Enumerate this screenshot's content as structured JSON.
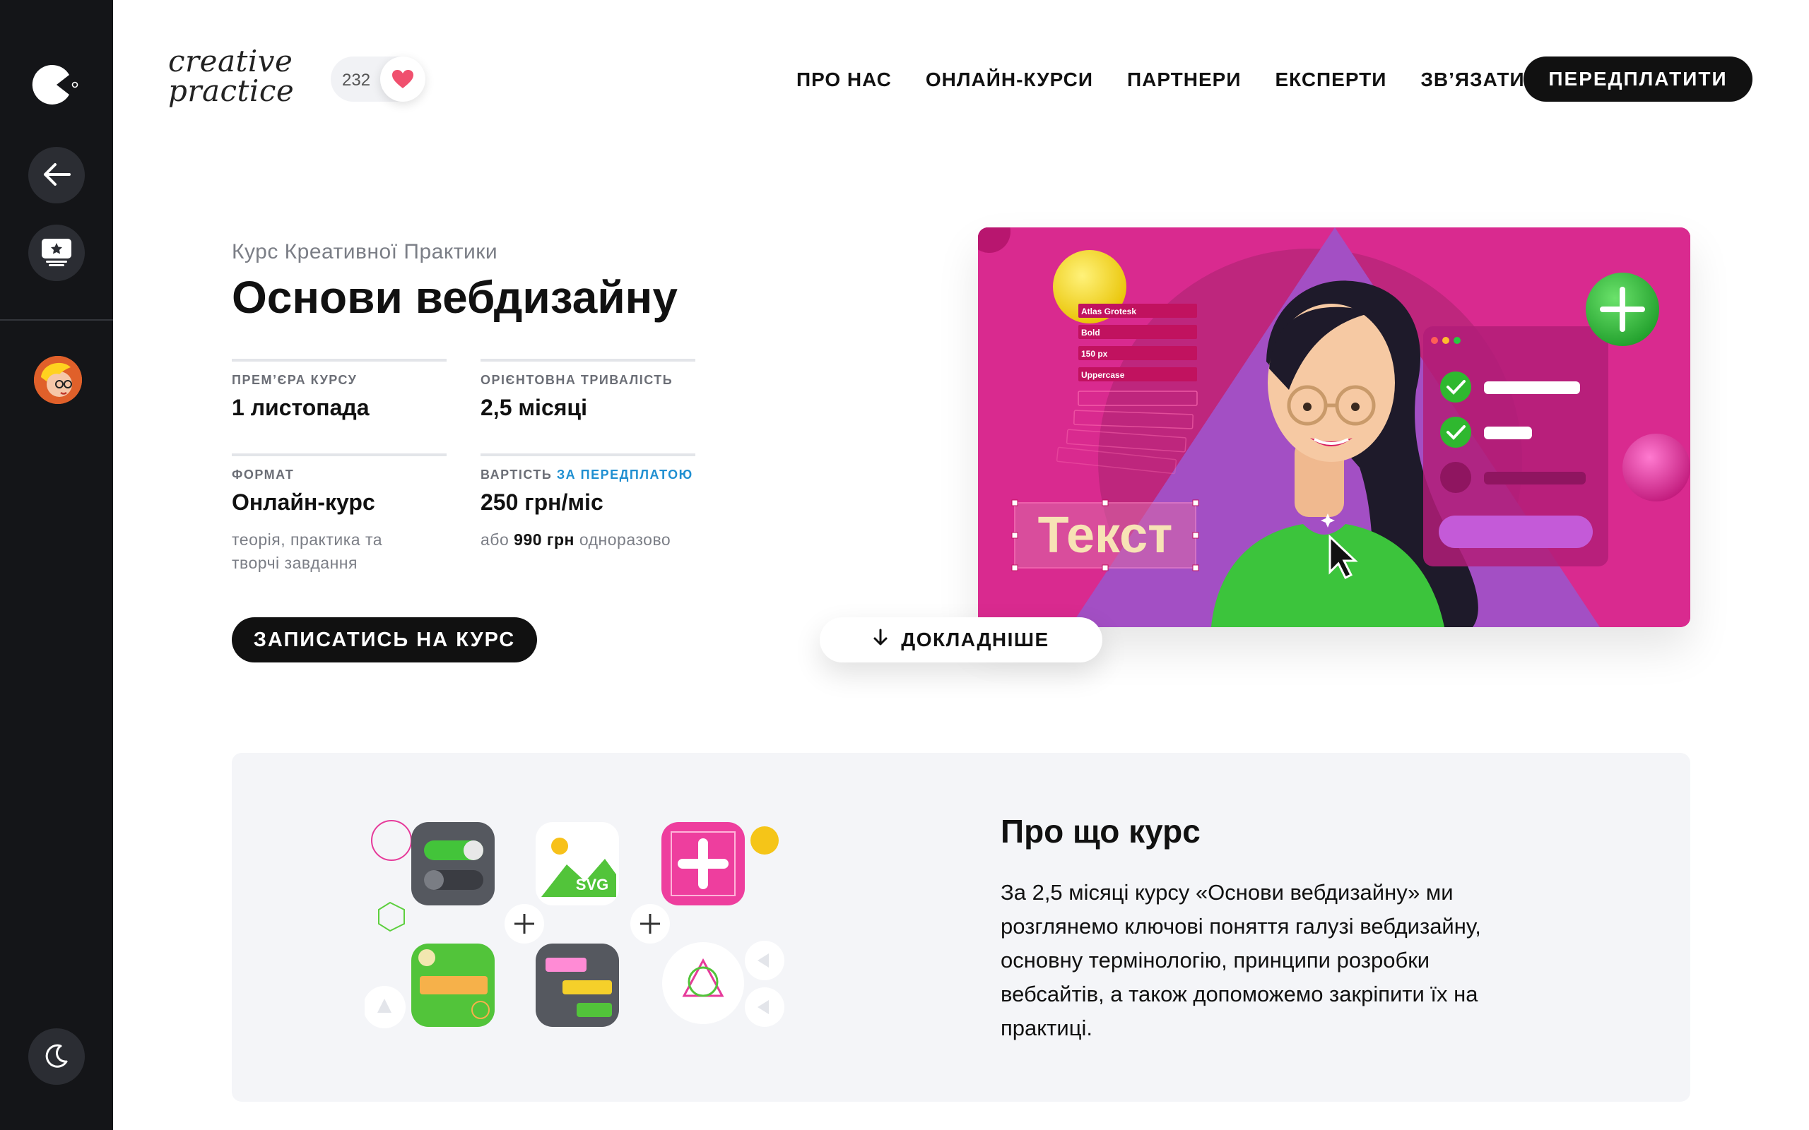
{
  "brand": {
    "line1": "creative",
    "line2": "practice"
  },
  "likes": {
    "count": "232"
  },
  "nav": {
    "items": [
      "ПРО НАС",
      "ОНЛАЙН-КУРСИ",
      "ПАРТНЕРИ",
      "ЕКСПЕРТИ",
      "ЗВ’ЯЗАТИСЯ"
    ],
    "subscribe_label": "ПЕРЕДПЛАТИТИ"
  },
  "sidebar": {
    "icons": [
      "logo-icon",
      "back-arrow-icon",
      "monitor-star-icon",
      "avatar",
      "moon-icon"
    ]
  },
  "course": {
    "kicker": "Курс Креативної Практики",
    "title": "Основи вебдизайну",
    "premiere_label": "ПРЕМ’ЄРА КУРСУ",
    "premiere_value": "1 листопада",
    "duration_label": "ОРІЄНТОВНА ТРИВАЛІСТЬ",
    "duration_value": "2,5 місяці",
    "format_label": "ФОРМАТ",
    "format_value": "Онлайн-курс",
    "format_note": "теорія, практика та творчі завдання",
    "price_label": "ВАРТІСТЬ",
    "price_label_accent": "ЗА ПЕРЕДПЛАТОЮ",
    "price_value": "250 грн/міс",
    "price_note_prefix": "або",
    "price_note_amount": "990 грн",
    "price_note_suffix": "одноразово",
    "enroll_label": "ЗАПИСАТИСЬ НА КУРС",
    "more_label": "ДОКЛАДНІШЕ"
  },
  "hero": {
    "font_dropdowns": [
      "Atlas Grotesk",
      "Bold",
      "150 px",
      "Uppercase"
    ],
    "sample_text": "Текст"
  },
  "about": {
    "title": "Про що курс",
    "text": "За 2,5 місяці курсу «Основи вебдизайну» ми розглянемо ключові поняття галузі вебдизайну, основну термінологію, принципи розробки вебсайтів, а також допоможемо закріпити їх на практиці.",
    "icon_badge": "SVG"
  },
  "colors": {
    "accent": "#1f8fd1",
    "hero_bg": "#d92a8f",
    "dark": "#111111",
    "sidebar": "#141518",
    "heart": "#f0506e"
  }
}
